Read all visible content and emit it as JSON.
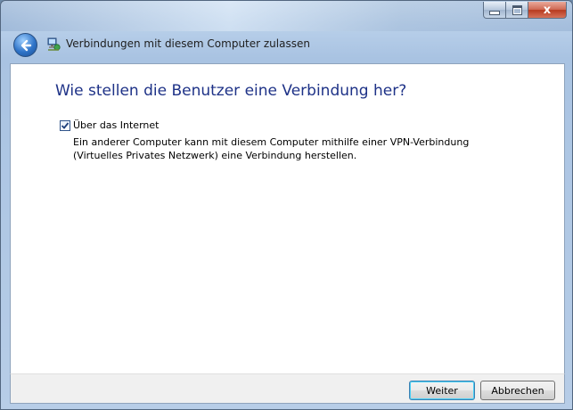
{
  "window": {
    "title": "Verbindungen mit diesem Computer zulassen",
    "close_glyph": "x"
  },
  "main": {
    "heading": "Wie stellen die Benutzer eine Verbindung her?",
    "option": {
      "checked": true,
      "label": "Über das Internet",
      "description": "Ein anderer Computer kann mit diesem Computer mithilfe einer VPN-Verbindung (Virtuelles Privates Netzwerk) eine Verbindung herstellen."
    }
  },
  "footer": {
    "next_label": "Weiter",
    "cancel_label": "Abbrechen"
  },
  "icons": {
    "back": "back-arrow-icon",
    "wizard": "network-computer-icon",
    "minimize": "minimize-icon",
    "maximize": "maximize-icon",
    "close": "close-icon",
    "check": "checkmark-icon"
  },
  "colors": {
    "heading": "#1e3287",
    "accent": "#2f74c8",
    "close": "#c4472c"
  }
}
